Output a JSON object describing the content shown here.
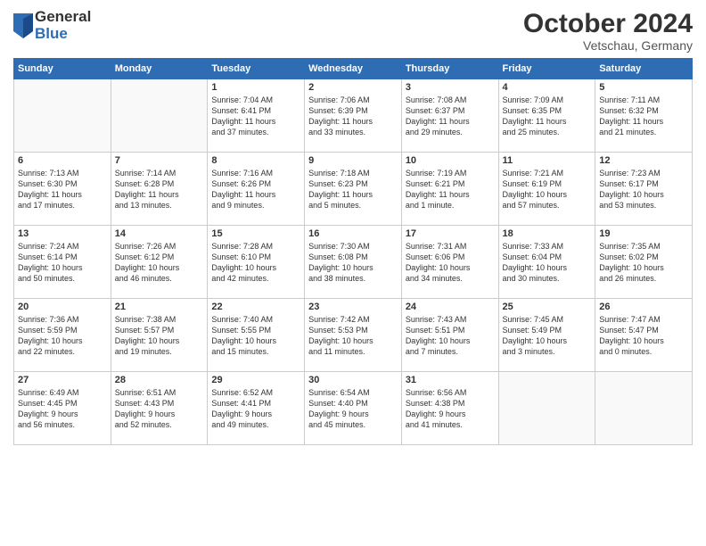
{
  "header": {
    "logo_general": "General",
    "logo_blue": "Blue",
    "month_title": "October 2024",
    "location": "Vetschau, Germany"
  },
  "days_of_week": [
    "Sunday",
    "Monday",
    "Tuesday",
    "Wednesday",
    "Thursday",
    "Friday",
    "Saturday"
  ],
  "weeks": [
    [
      {
        "day": "",
        "info": ""
      },
      {
        "day": "",
        "info": ""
      },
      {
        "day": "1",
        "info": "Sunrise: 7:04 AM\nSunset: 6:41 PM\nDaylight: 11 hours\nand 37 minutes."
      },
      {
        "day": "2",
        "info": "Sunrise: 7:06 AM\nSunset: 6:39 PM\nDaylight: 11 hours\nand 33 minutes."
      },
      {
        "day": "3",
        "info": "Sunrise: 7:08 AM\nSunset: 6:37 PM\nDaylight: 11 hours\nand 29 minutes."
      },
      {
        "day": "4",
        "info": "Sunrise: 7:09 AM\nSunset: 6:35 PM\nDaylight: 11 hours\nand 25 minutes."
      },
      {
        "day": "5",
        "info": "Sunrise: 7:11 AM\nSunset: 6:32 PM\nDaylight: 11 hours\nand 21 minutes."
      }
    ],
    [
      {
        "day": "6",
        "info": "Sunrise: 7:13 AM\nSunset: 6:30 PM\nDaylight: 11 hours\nand 17 minutes."
      },
      {
        "day": "7",
        "info": "Sunrise: 7:14 AM\nSunset: 6:28 PM\nDaylight: 11 hours\nand 13 minutes."
      },
      {
        "day": "8",
        "info": "Sunrise: 7:16 AM\nSunset: 6:26 PM\nDaylight: 11 hours\nand 9 minutes."
      },
      {
        "day": "9",
        "info": "Sunrise: 7:18 AM\nSunset: 6:23 PM\nDaylight: 11 hours\nand 5 minutes."
      },
      {
        "day": "10",
        "info": "Sunrise: 7:19 AM\nSunset: 6:21 PM\nDaylight: 11 hours\nand 1 minute."
      },
      {
        "day": "11",
        "info": "Sunrise: 7:21 AM\nSunset: 6:19 PM\nDaylight: 10 hours\nand 57 minutes."
      },
      {
        "day": "12",
        "info": "Sunrise: 7:23 AM\nSunset: 6:17 PM\nDaylight: 10 hours\nand 53 minutes."
      }
    ],
    [
      {
        "day": "13",
        "info": "Sunrise: 7:24 AM\nSunset: 6:14 PM\nDaylight: 10 hours\nand 50 minutes."
      },
      {
        "day": "14",
        "info": "Sunrise: 7:26 AM\nSunset: 6:12 PM\nDaylight: 10 hours\nand 46 minutes."
      },
      {
        "day": "15",
        "info": "Sunrise: 7:28 AM\nSunset: 6:10 PM\nDaylight: 10 hours\nand 42 minutes."
      },
      {
        "day": "16",
        "info": "Sunrise: 7:30 AM\nSunset: 6:08 PM\nDaylight: 10 hours\nand 38 minutes."
      },
      {
        "day": "17",
        "info": "Sunrise: 7:31 AM\nSunset: 6:06 PM\nDaylight: 10 hours\nand 34 minutes."
      },
      {
        "day": "18",
        "info": "Sunrise: 7:33 AM\nSunset: 6:04 PM\nDaylight: 10 hours\nand 30 minutes."
      },
      {
        "day": "19",
        "info": "Sunrise: 7:35 AM\nSunset: 6:02 PM\nDaylight: 10 hours\nand 26 minutes."
      }
    ],
    [
      {
        "day": "20",
        "info": "Sunrise: 7:36 AM\nSunset: 5:59 PM\nDaylight: 10 hours\nand 22 minutes."
      },
      {
        "day": "21",
        "info": "Sunrise: 7:38 AM\nSunset: 5:57 PM\nDaylight: 10 hours\nand 19 minutes."
      },
      {
        "day": "22",
        "info": "Sunrise: 7:40 AM\nSunset: 5:55 PM\nDaylight: 10 hours\nand 15 minutes."
      },
      {
        "day": "23",
        "info": "Sunrise: 7:42 AM\nSunset: 5:53 PM\nDaylight: 10 hours\nand 11 minutes."
      },
      {
        "day": "24",
        "info": "Sunrise: 7:43 AM\nSunset: 5:51 PM\nDaylight: 10 hours\nand 7 minutes."
      },
      {
        "day": "25",
        "info": "Sunrise: 7:45 AM\nSunset: 5:49 PM\nDaylight: 10 hours\nand 3 minutes."
      },
      {
        "day": "26",
        "info": "Sunrise: 7:47 AM\nSunset: 5:47 PM\nDaylight: 10 hours\nand 0 minutes."
      }
    ],
    [
      {
        "day": "27",
        "info": "Sunrise: 6:49 AM\nSunset: 4:45 PM\nDaylight: 9 hours\nand 56 minutes."
      },
      {
        "day": "28",
        "info": "Sunrise: 6:51 AM\nSunset: 4:43 PM\nDaylight: 9 hours\nand 52 minutes."
      },
      {
        "day": "29",
        "info": "Sunrise: 6:52 AM\nSunset: 4:41 PM\nDaylight: 9 hours\nand 49 minutes."
      },
      {
        "day": "30",
        "info": "Sunrise: 6:54 AM\nSunset: 4:40 PM\nDaylight: 9 hours\nand 45 minutes."
      },
      {
        "day": "31",
        "info": "Sunrise: 6:56 AM\nSunset: 4:38 PM\nDaylight: 9 hours\nand 41 minutes."
      },
      {
        "day": "",
        "info": ""
      },
      {
        "day": "",
        "info": ""
      }
    ]
  ]
}
